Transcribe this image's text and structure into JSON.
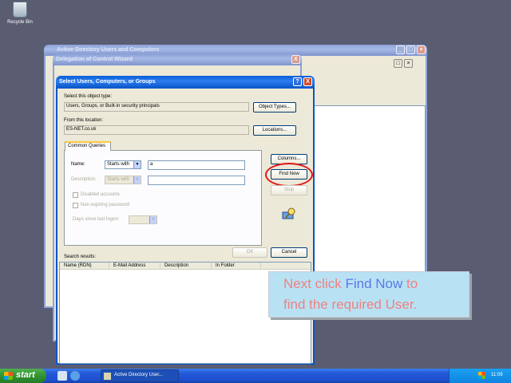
{
  "desktop": {
    "recycle_bin": "Recycle Bin"
  },
  "ad_window": {
    "title": "Active Directory Users and Computers"
  },
  "wizard": {
    "title": "Delegation of Control Wizard",
    "help": "?",
    "close": "X"
  },
  "dialog": {
    "title": "Select Users, Computers, or Groups",
    "help": "?",
    "close": "X",
    "object_type_label": "Select this object type:",
    "object_type_value": "Users, Groups, or Built-in security principals",
    "object_types_btn": "Object Types...",
    "location_label": "From this location:",
    "location_value": "ES-NET.co.uk",
    "locations_btn": "Locations...",
    "tab": "Common Queries",
    "name_label": "Name:",
    "name_op": "Starts with",
    "name_value": "a",
    "desc_label": "Description:",
    "desc_op": "Starts with",
    "disabled_accounts": "Disabled accounts",
    "non_expiring": "Non expiring password",
    "days_label": "Days since last logon:",
    "columns_btn": "Columns...",
    "find_now_btn": "Find Now",
    "stop_btn": "Stop",
    "ok_btn": "OK",
    "cancel_btn": "Cancel",
    "results_label": "Search results:",
    "columns": [
      "Name (RDN)",
      "E-Mail Address",
      "Description",
      "In Folder"
    ]
  },
  "callout": {
    "line1a": "Next click ",
    "line1b": "Find Now",
    "line1c": " to",
    "line2": "find the required User."
  },
  "taskbar": {
    "start": "start",
    "task": "Active Directory User...",
    "lang": "EN",
    "clock": "11:09"
  },
  "colors": {
    "highlight_circle": "#e01818",
    "callout_text": "#f08080",
    "callout_highlight": "#5a78e8"
  }
}
